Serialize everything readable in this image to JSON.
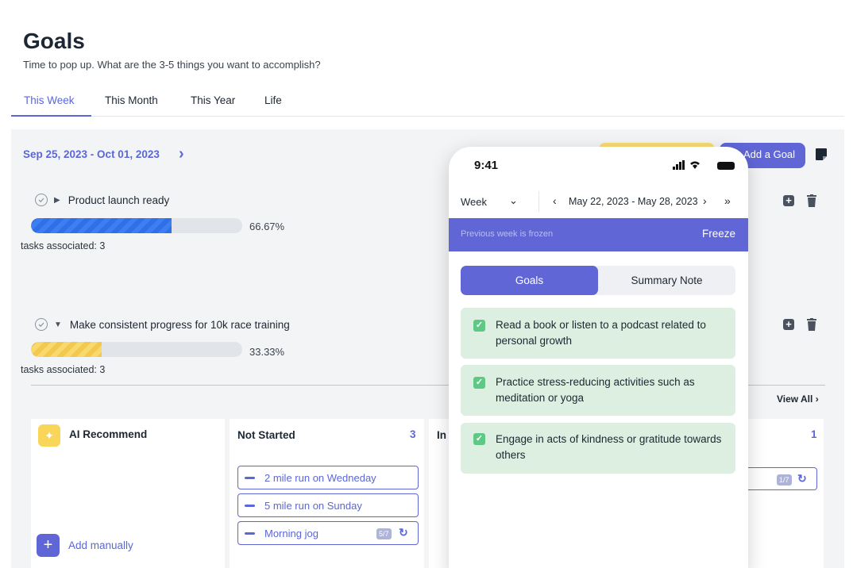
{
  "header": {
    "title": "Goals",
    "subtitle": "Time to pop up. What are the 3-5 things you want to accomplish?"
  },
  "tabs": [
    {
      "label": "This Week",
      "active": true
    },
    {
      "label": "This Month",
      "active": false
    },
    {
      "label": "This Year",
      "active": false
    },
    {
      "label": "Life",
      "active": false
    }
  ],
  "week": {
    "date_range": "Sep 25, 2023 - Oct 01, 2023",
    "add_goal_label": "Add a Goal"
  },
  "goals": [
    {
      "title": "Product launch ready",
      "progress_label": "66.67%",
      "progress": 0.6667,
      "tasks_label": "tasks associated: 3",
      "expanded": false
    },
    {
      "title": "Make consistent progress for 10k race training",
      "progress_label": "33.33%",
      "progress": 0.3333,
      "tasks_label": "tasks associated: 3",
      "expanded": true
    }
  ],
  "board": {
    "view_all": "View All",
    "ai_recommend": "AI Recommend",
    "add_manually": "Add manually",
    "not_started": {
      "title": "Not Started",
      "count": "3",
      "tasks": [
        {
          "label": "2 mile run on Wedneday"
        },
        {
          "label": "5 mile run on Sunday"
        },
        {
          "label": "Morning jog",
          "badge": "5/7"
        }
      ]
    },
    "in_progress": {
      "title": "In"
    },
    "right_column": {
      "count": "1",
      "badge": "1/7"
    }
  },
  "phone": {
    "time": "9:41",
    "signal": "▂▄▆ •",
    "period": "Week",
    "range": "May 22, 2023 - May 28, 2023",
    "frozen_text": "Previous week is frozen",
    "freeze_label": "Freeze",
    "segment_goals": "Goals",
    "segment_summary": "Summary Note",
    "items": [
      {
        "text": "Read a book or listen to a podcast related to personal growth",
        "checked": true
      },
      {
        "text": "Practice stress-reducing activities such as meditation or yoga",
        "checked": true
      },
      {
        "text": "Engage in acts of kindness or gratitude towards others",
        "checked": true
      }
    ]
  },
  "colors": {
    "accent": "#6066d6",
    "accent_text": "#5b67d8",
    "progress_blue": "#2f6fe8",
    "progress_yellow": "#f2c94c",
    "card_green": "#dcefe1",
    "check_green": "#5fc884",
    "highlight_yellow": "#f8dc73"
  }
}
